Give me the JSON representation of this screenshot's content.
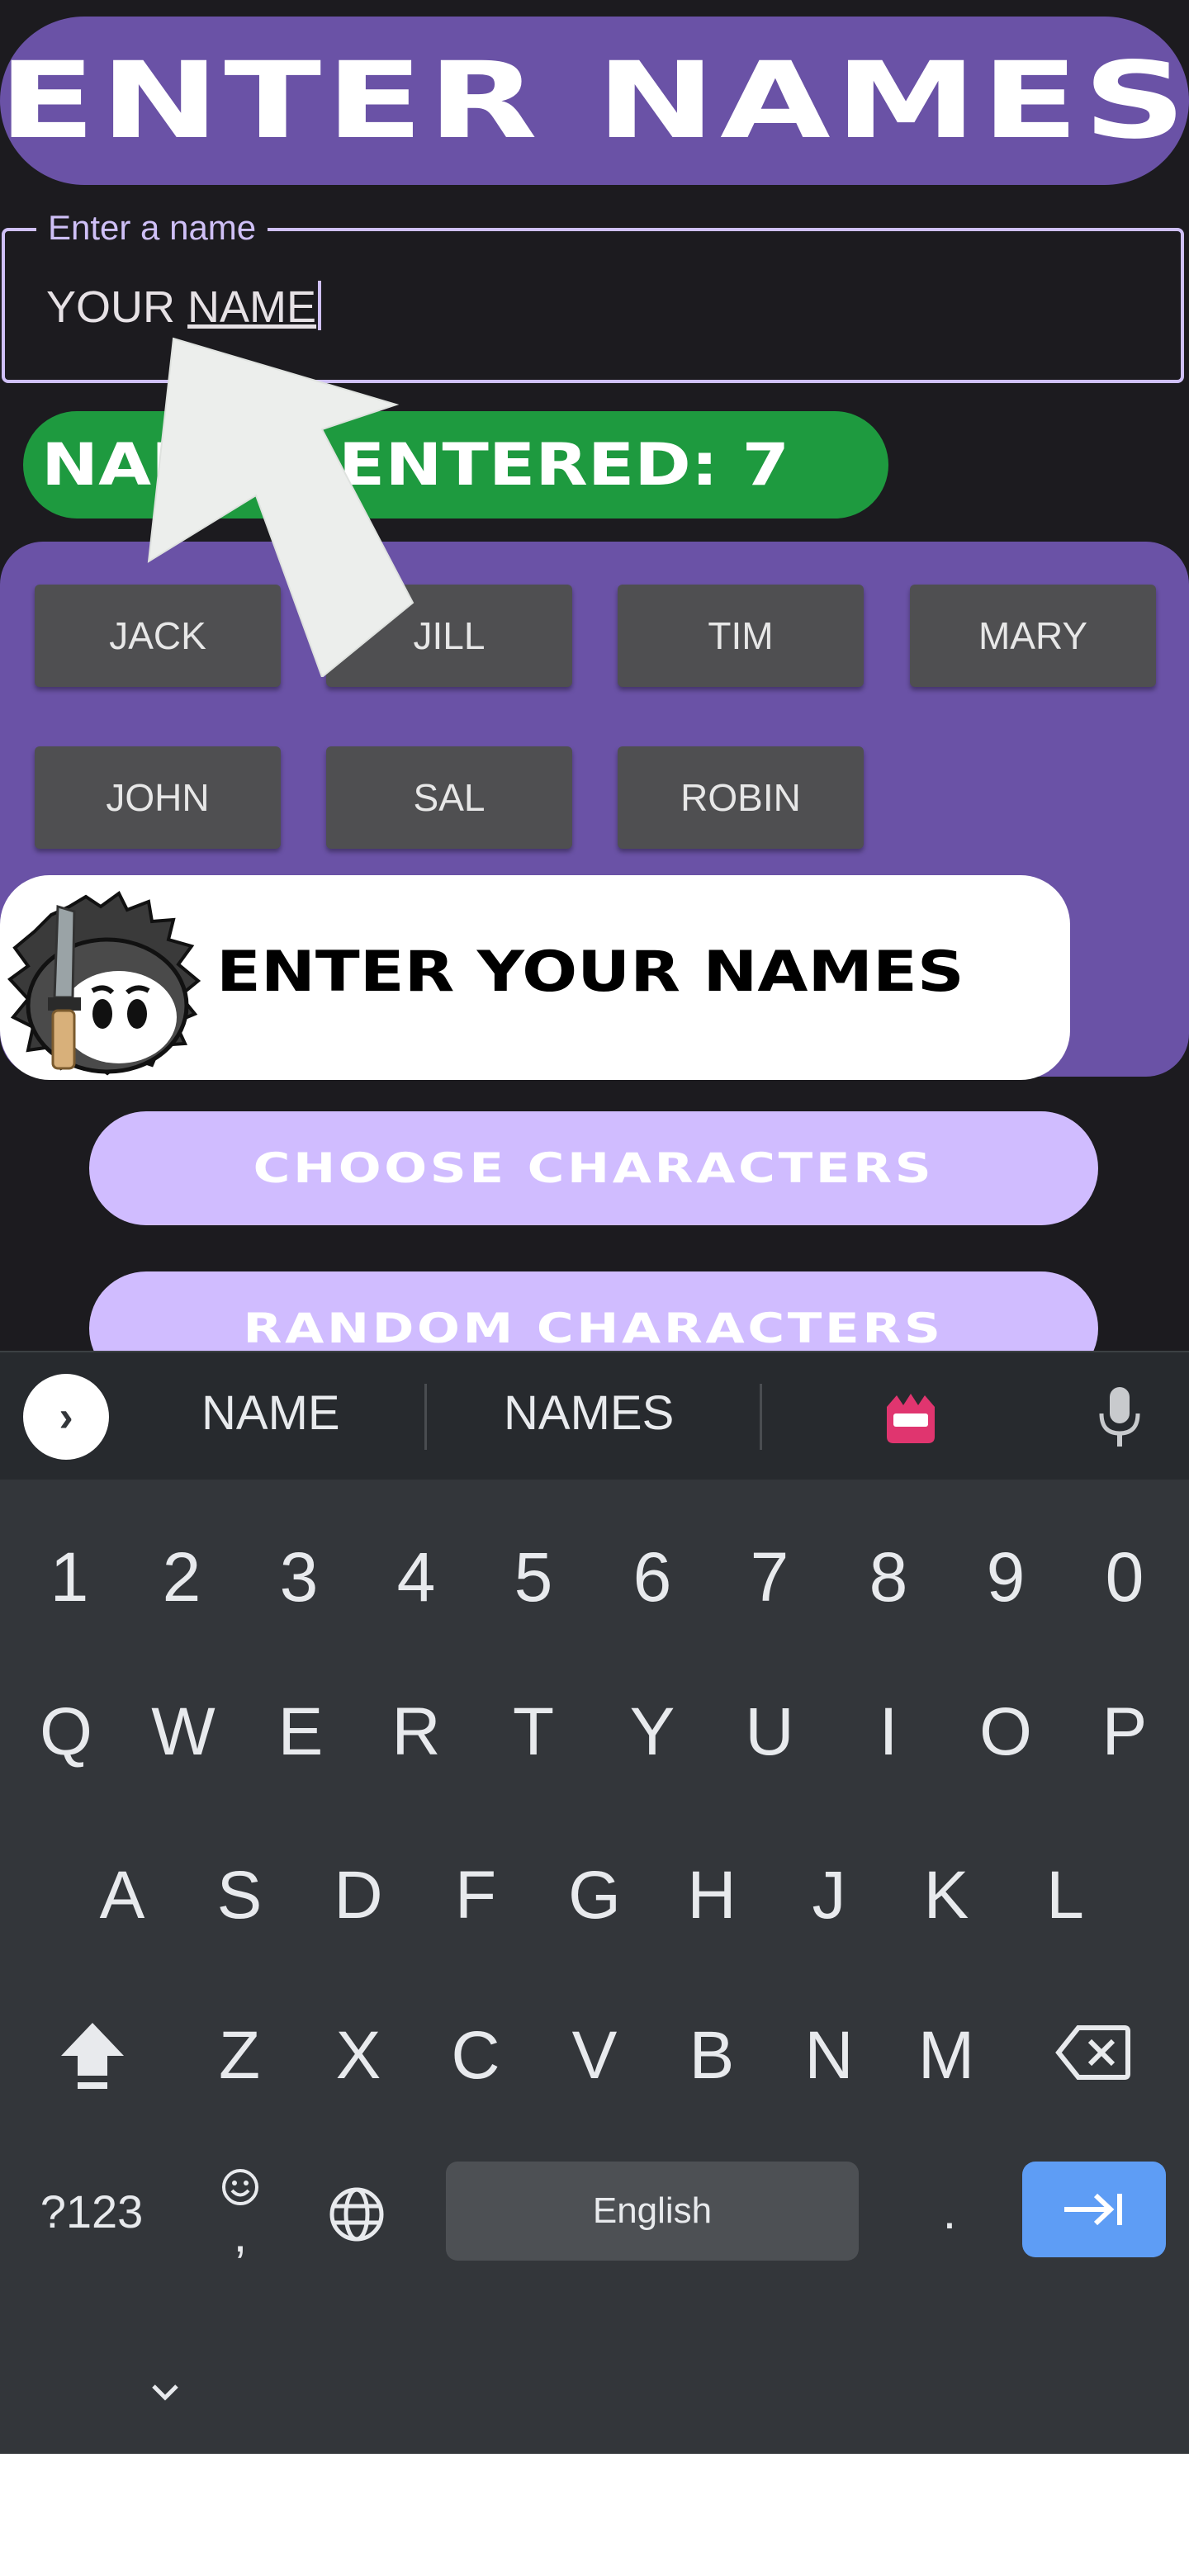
{
  "header": {
    "title": "ENTER NAMES"
  },
  "name_input": {
    "label": "Enter a name",
    "value_prefix": "YOUR ",
    "value_underlined": "NAME"
  },
  "counter": {
    "text": "NAMES ENTERED: 7"
  },
  "names": [
    {
      "label": "JACK"
    },
    {
      "label": "JILL"
    },
    {
      "label": "TIM"
    },
    {
      "label": "MARY"
    },
    {
      "label": "JOHN"
    },
    {
      "label": "SAL"
    },
    {
      "label": "ROBIN"
    }
  ],
  "banner": {
    "text": "ENTER YOUR NAMES"
  },
  "actions": {
    "choose": "CHOOSE CHARACTERS",
    "random": "RANDOM CHARACTERS"
  },
  "keyboard": {
    "suggestions": [
      "NAME",
      "NAMES"
    ],
    "row_numbers": [
      "1",
      "2",
      "3",
      "4",
      "5",
      "6",
      "7",
      "8",
      "9",
      "0"
    ],
    "row_top": [
      "Q",
      "W",
      "E",
      "R",
      "T",
      "Y",
      "U",
      "I",
      "O",
      "P"
    ],
    "row_mid": [
      "A",
      "S",
      "D",
      "F",
      "G",
      "H",
      "J",
      "K",
      "L"
    ],
    "row_bottom": [
      "Z",
      "X",
      "C",
      "V",
      "B",
      "N",
      "M"
    ],
    "symbols_label": "?123",
    "comma": ",",
    "period": ".",
    "space_label": "English"
  },
  "colors": {
    "accent_purple": "#6a52a6",
    "light_purple": "#d0bcff",
    "green": "#1e9a3f",
    "enter_blue": "#5e9df5"
  },
  "icons": [
    "arrow-pointer-icon",
    "chevron-right-icon",
    "emoji-suggestion-icon",
    "microphone-icon",
    "shift-icon",
    "backspace-icon",
    "emoji-icon",
    "globe-icon",
    "enter-icon",
    "hide-keyboard-icon"
  ]
}
